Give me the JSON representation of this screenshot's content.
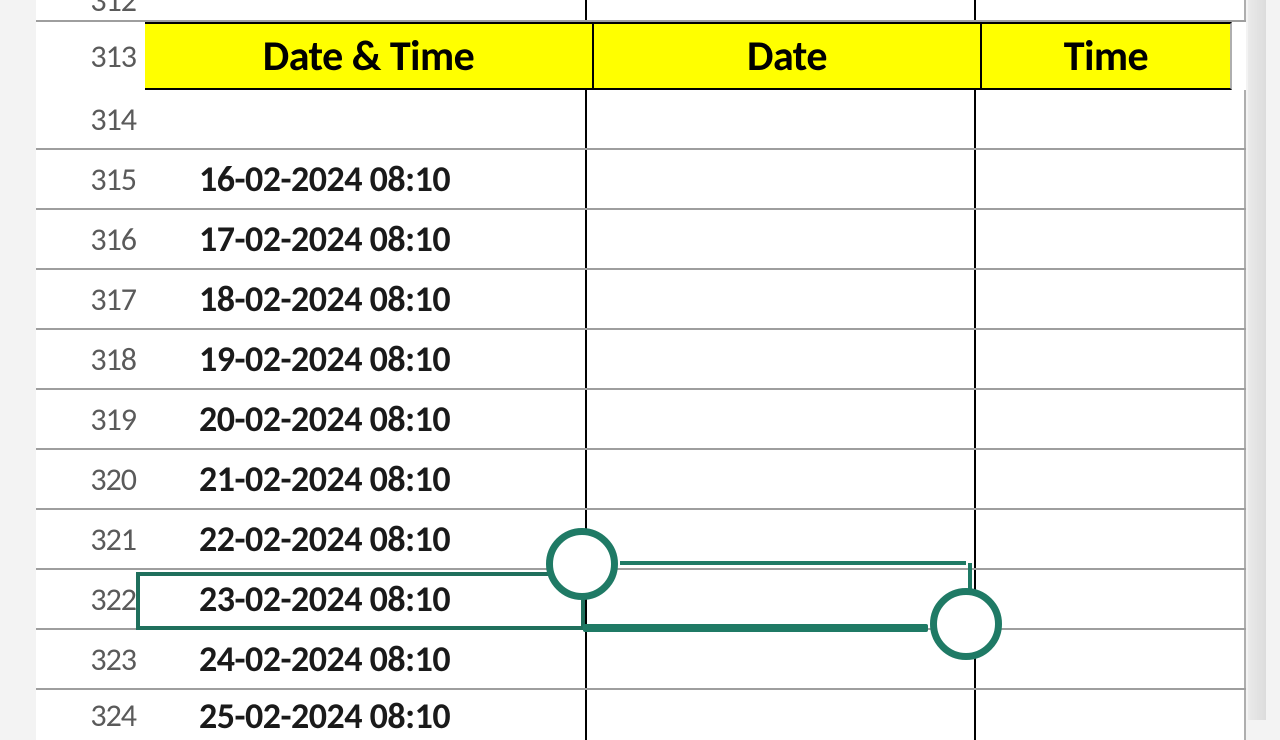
{
  "columns": {
    "a": "Date & Time",
    "b": "Date",
    "c": "Time"
  },
  "rows": [
    {
      "num": "312",
      "a": "",
      "b": "",
      "c": ""
    },
    {
      "num": "313",
      "a": "",
      "b": "",
      "c": "",
      "header": true
    },
    {
      "num": "314",
      "a": "",
      "b": "",
      "c": ""
    },
    {
      "num": "315",
      "a": "16-02-2024 08:10",
      "b": "",
      "c": ""
    },
    {
      "num": "316",
      "a": "17-02-2024 08:10",
      "b": "",
      "c": ""
    },
    {
      "num": "317",
      "a": "18-02-2024 08:10",
      "b": "",
      "c": ""
    },
    {
      "num": "318",
      "a": "19-02-2024 08:10",
      "b": "",
      "c": ""
    },
    {
      "num": "319",
      "a": "20-02-2024 08:10",
      "b": "",
      "c": ""
    },
    {
      "num": "320",
      "a": "21-02-2024 08:10",
      "b": "",
      "c": ""
    },
    {
      "num": "321",
      "a": "22-02-2024 08:10",
      "b": "",
      "c": ""
    },
    {
      "num": "322",
      "a": "23-02-2024 08:10",
      "b": "",
      "c": "",
      "selected": true
    },
    {
      "num": "323",
      "a": "24-02-2024 08:10",
      "b": "",
      "c": ""
    },
    {
      "num": "324",
      "a": "25-02-2024 08:10",
      "b": "",
      "c": ""
    }
  ],
  "selection": {
    "active_cell": "B322"
  }
}
